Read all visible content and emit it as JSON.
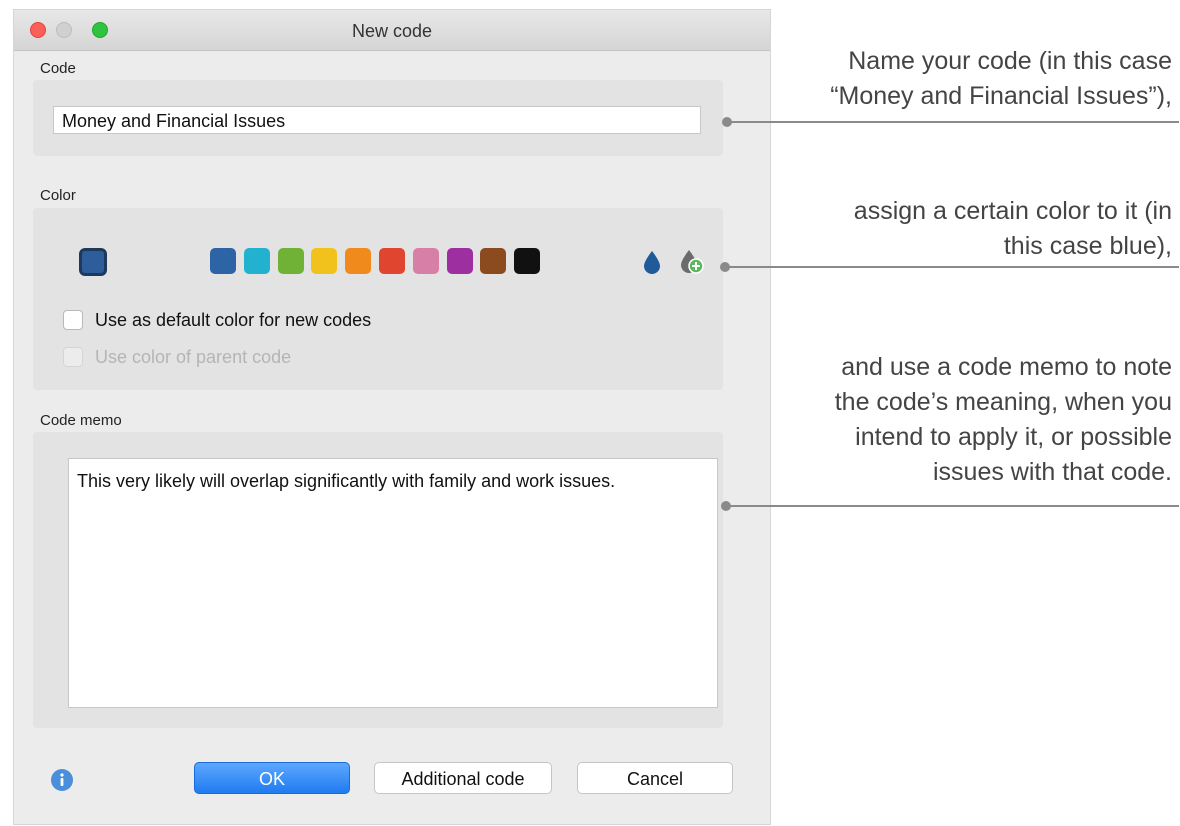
{
  "window": {
    "title": "New code"
  },
  "code": {
    "label": "Code",
    "value": "Money and Financial Issues"
  },
  "color": {
    "label": "Color",
    "selected": "#2d5e9b",
    "palette": [
      "#2d64a6",
      "#22b1cf",
      "#6fb236",
      "#f2c21c",
      "#f08a1d",
      "#e0452f",
      "#d87fa8",
      "#9d2fa1",
      "#8c4a1f",
      "#111111"
    ],
    "default_checkbox": "Use as default color for new codes",
    "parent_checkbox": "Use color of parent code"
  },
  "memo": {
    "label": "Code memo",
    "text": "This very likely will overlap significantly with family and work issues."
  },
  "buttons": {
    "ok": "OK",
    "additional": "Additional code",
    "cancel": "Cancel"
  },
  "annotations": {
    "a1_line1": "Name your code (in this case",
    "a1_line2": "“Money and Financial Issues”),",
    "a2_line1": "assign a certain color to it (in",
    "a2_line2": "this case blue),",
    "a3_line1": "and use a code memo to note",
    "a3_line2": "the code’s meaning, when you",
    "a3_line3": "intend to apply it, or possible",
    "a3_line4": "issues with that code."
  }
}
